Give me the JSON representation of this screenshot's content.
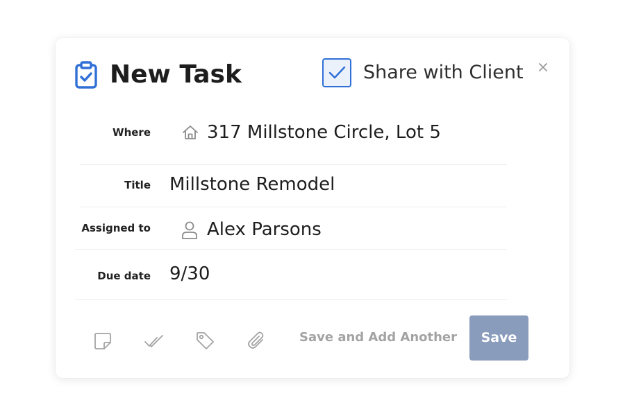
{
  "dialog": {
    "title": "New Task",
    "share": {
      "label": "Share with Client",
      "checked": true
    },
    "close_glyph": "×"
  },
  "fields": {
    "where": {
      "label": "Where",
      "value": "317 Millstone Circle, Lot 5",
      "icon": "home-icon"
    },
    "title": {
      "label": "Title",
      "value": "Millstone Remodel"
    },
    "assigned": {
      "label": "Assigned to",
      "value": "Alex Parsons",
      "icon": "person-icon"
    },
    "due": {
      "label": "Due date",
      "value": "9/30"
    }
  },
  "toolbar": {
    "icons": [
      "note-icon",
      "checklist-icon",
      "tag-icon",
      "attachment-icon"
    ],
    "save_another_label": "Save and Add Another",
    "save_label": "Save"
  },
  "colors": {
    "accent": "#2f6fd6",
    "save_button": "#8a9cbc",
    "muted_text": "#a3a3a3"
  }
}
